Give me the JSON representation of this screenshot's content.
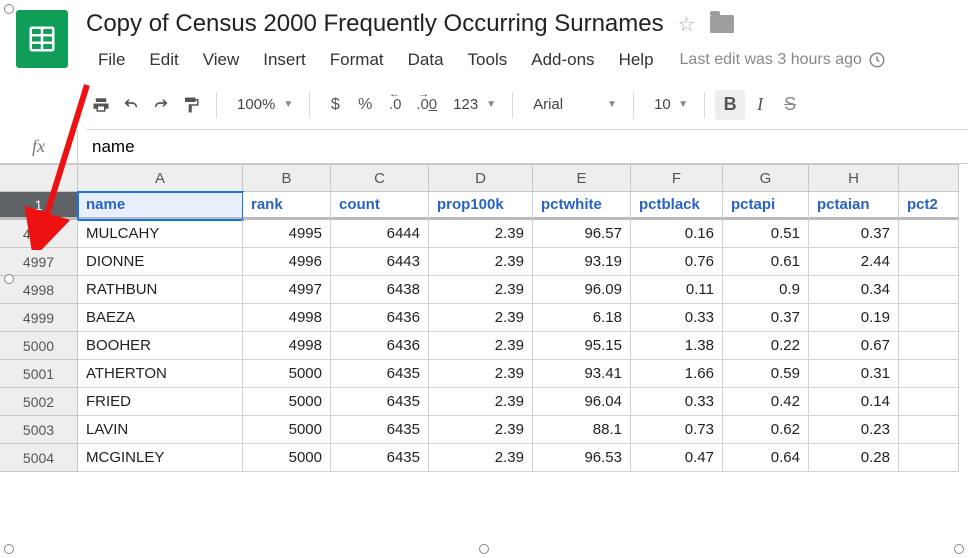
{
  "doc": {
    "title": "Copy of Census 2000 Frequently Occurring Surnames",
    "last_edit": "Last edit was 3 hours ago"
  },
  "menu": [
    "File",
    "Edit",
    "View",
    "Insert",
    "Format",
    "Data",
    "Tools",
    "Add-ons",
    "Help"
  ],
  "toolbar": {
    "zoom": "100%",
    "currency": "$",
    "percent": "%",
    "dec_dec": ".0",
    "inc_dec": ".00",
    "num_fmt": "123",
    "font": "Arial",
    "font_size": "10",
    "bold": "B",
    "italic": "I",
    "strike": "S"
  },
  "fx": {
    "label": "fx",
    "value": "name"
  },
  "columns": [
    {
      "letter": "A",
      "width": "cA"
    },
    {
      "letter": "B",
      "width": "cB"
    },
    {
      "letter": "C",
      "width": "cC"
    },
    {
      "letter": "D",
      "width": "cD"
    },
    {
      "letter": "E",
      "width": "cE"
    },
    {
      "letter": "F",
      "width": "cF"
    },
    {
      "letter": "G",
      "width": "cG"
    },
    {
      "letter": "H",
      "width": "cH"
    },
    {
      "letter": "",
      "width": "cI"
    }
  ],
  "headers": [
    "name",
    "rank",
    "count",
    "prop100k",
    "pctwhite",
    "pctblack",
    "pctapi",
    "pctaian",
    "pct2"
  ],
  "header_row_num": "1",
  "selected_cell": "A1",
  "rows": [
    {
      "r": "4996",
      "c": [
        "MULCAHY",
        "4995",
        "6444",
        "2.39",
        "96.57",
        "0.16",
        "0.51",
        "0.37",
        ""
      ]
    },
    {
      "r": "4997",
      "c": [
        "DIONNE",
        "4996",
        "6443",
        "2.39",
        "93.19",
        "0.76",
        "0.61",
        "2.44",
        ""
      ]
    },
    {
      "r": "4998",
      "c": [
        "RATHBUN",
        "4997",
        "6438",
        "2.39",
        "96.09",
        "0.11",
        "0.9",
        "0.34",
        ""
      ]
    },
    {
      "r": "4999",
      "c": [
        "BAEZA",
        "4998",
        "6436",
        "2.39",
        "6.18",
        "0.33",
        "0.37",
        "0.19",
        ""
      ]
    },
    {
      "r": "5000",
      "c": [
        "BOOHER",
        "4998",
        "6436",
        "2.39",
        "95.15",
        "1.38",
        "0.22",
        "0.67",
        ""
      ]
    },
    {
      "r": "5001",
      "c": [
        "ATHERTON",
        "5000",
        "6435",
        "2.39",
        "93.41",
        "1.66",
        "0.59",
        "0.31",
        ""
      ]
    },
    {
      "r": "5002",
      "c": [
        "FRIED",
        "5000",
        "6435",
        "2.39",
        "96.04",
        "0.33",
        "0.42",
        "0.14",
        ""
      ]
    },
    {
      "r": "5003",
      "c": [
        "LAVIN",
        "5000",
        "6435",
        "2.39",
        "88.1",
        "0.73",
        "0.62",
        "0.23",
        ""
      ]
    },
    {
      "r": "5004",
      "c": [
        "MCGINLEY",
        "5000",
        "6435",
        "2.39",
        "96.53",
        "0.47",
        "0.64",
        "0.28",
        ""
      ]
    }
  ]
}
